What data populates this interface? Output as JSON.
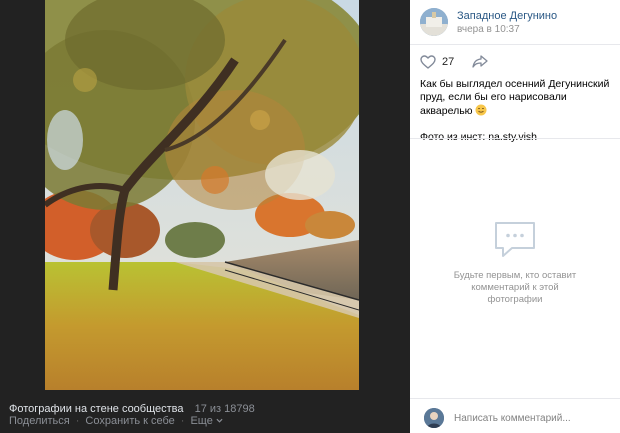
{
  "viewer": {
    "album_label": "Фотографии на стене сообщества",
    "counter": "17 из 18798",
    "share_label": "Поделиться",
    "save_label": "Сохранить к себе",
    "more_label": "Еще"
  },
  "post": {
    "group_name": "Западное Дегунино",
    "time": "вчера в 10:37",
    "likes_count": "27",
    "text_line": "Как бы выглядел осенний Дегунинский пруд, если бы его нарисовали акварелью",
    "source_line": "Фото из инст: na.sty.vish"
  },
  "comments": {
    "empty_text": "Будьте первым, кто оставит комментарий к этой фотографии",
    "input_placeholder": "Написать комментарий..."
  },
  "icons": {
    "like": "heart-icon",
    "share": "share-arrow-icon",
    "comments_empty": "comment-bubble-icon",
    "dropdown": "chevron-down-icon",
    "emoji": "smiling-face-emoji"
  },
  "colors": {
    "viewer_bg": "#222222",
    "link": "#2a5885",
    "muted": "#939393"
  }
}
